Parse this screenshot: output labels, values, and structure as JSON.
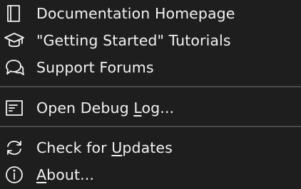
{
  "menu": {
    "items": [
      {
        "label": "Documentation Homepage",
        "icon": "book-icon"
      },
      {
        "label": "\"Getting Started\" Tutorials",
        "icon": "graduation-cap-icon"
      },
      {
        "label": "Support Forums",
        "icon": "chat-bubbles-icon"
      },
      {
        "label_pre": "Open Debug ",
        "label_acc": "L",
        "label_post": "og...",
        "icon": "debug-log-icon"
      },
      {
        "label_pre": "Check for ",
        "label_acc": "U",
        "label_post": "pdates",
        "icon": "refresh-icon"
      },
      {
        "label_pre": "",
        "label_acc": "A",
        "label_post": "bout...",
        "icon": "info-icon"
      }
    ]
  }
}
